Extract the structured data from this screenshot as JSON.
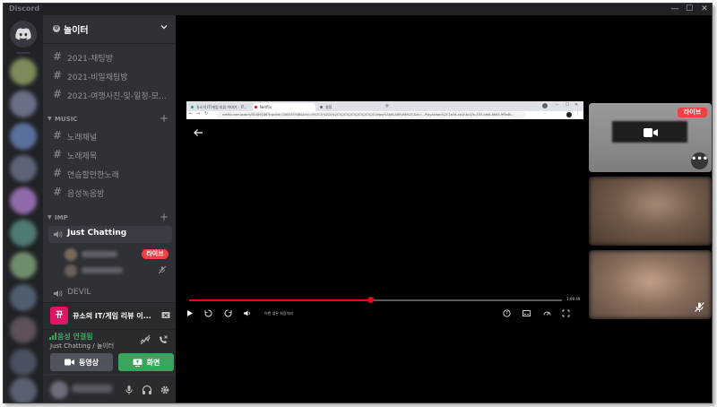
{
  "window": {
    "app_title": "Discord",
    "minimize_glyph": "—",
    "maximize_glyph": "☐",
    "close_glyph": "✕"
  },
  "guild": {
    "badge": "0",
    "name": "놀이터"
  },
  "text_channels": [
    {
      "name": "2021-채팅방"
    },
    {
      "name": "2021-비밀채팅방"
    },
    {
      "name": "2021-여행사진-및-일정-모..."
    }
  ],
  "categories": {
    "music": {
      "name": "MUSIC",
      "channels": [
        {
          "name": "노래채널"
        },
        {
          "name": "노래제목"
        },
        {
          "name": "연습할만한노래"
        },
        {
          "name": "음성녹음방"
        }
      ]
    },
    "imp": {
      "name": "IMP"
    }
  },
  "voice_channels": {
    "active": {
      "name": "Just Chatting"
    },
    "member_live_badge": "라이브",
    "other": {
      "name": "DEVIL"
    }
  },
  "stream_panel": {
    "avatar_letter": "뀨",
    "title": "뀨소의 IT/게임 리뷰 이..."
  },
  "voice_panel": {
    "status": "음성 연결됨",
    "location": "Just Chatting / 놀이터",
    "video_label": "동영상",
    "screen_label": "화면"
  },
  "browser": {
    "tabs": [
      {
        "label": "뀨소의 IT/게임 리뷰 이야기 - IT..."
      },
      {
        "label": "Netflix"
      },
      {
        "label": "설정"
      }
    ],
    "address": "netflix.com/watch/81489186?trackId=260035548&tctx=0%2C0%2C0%2C%2C%2C%2C%2C%2CVideo%3A81489186%2C&tc=...PlayAction%2C1a3d-4d1f-8c47b-155-4fd6-86d3-9f5a8f..."
  },
  "player": {
    "progress_fraction": 0.485,
    "time_remaining": "1:09:49",
    "title": "이번 생은 처음이라"
  },
  "tiles": {
    "live_label": "라이브",
    "more_label": "•••"
  },
  "colors": {
    "accent_green": "#3ba55d",
    "live_red": "#ed4245",
    "netflix_red": "#e50914",
    "sidebar_bg": "#2f3136"
  }
}
